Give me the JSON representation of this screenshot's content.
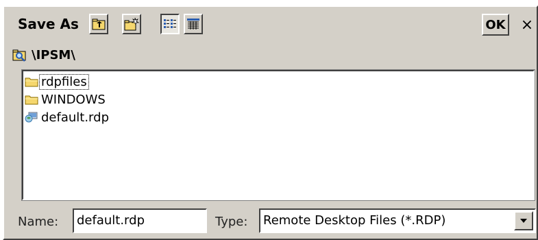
{
  "dialog": {
    "title": "Save As",
    "ok_label": "OK",
    "close_label": "×"
  },
  "toolbar": {
    "buttons": [
      {
        "icon": "up-folder-icon"
      },
      {
        "icon": "new-folder-icon"
      },
      {
        "icon": "list-view-icon",
        "pressed": true
      },
      {
        "icon": "details-view-icon"
      }
    ]
  },
  "path": {
    "text": "\\IPSM\\",
    "icon": "folder-search-icon"
  },
  "files": [
    {
      "name": "rdpfiles",
      "icon": "folder-icon",
      "focused": true
    },
    {
      "name": "WINDOWS",
      "icon": "folder-icon"
    },
    {
      "name": "default.rdp",
      "icon": "remote-desktop-file-icon"
    }
  ],
  "form": {
    "name_label": "Name:",
    "name_value": "default.rdp",
    "type_label": "Type:",
    "type_value": "Remote Desktop Files (*.RDP)"
  },
  "colors": {
    "dialog_bg": "#d4d0c8",
    "folder": "#f5d76e",
    "accent_blue": "#2a5db0"
  }
}
